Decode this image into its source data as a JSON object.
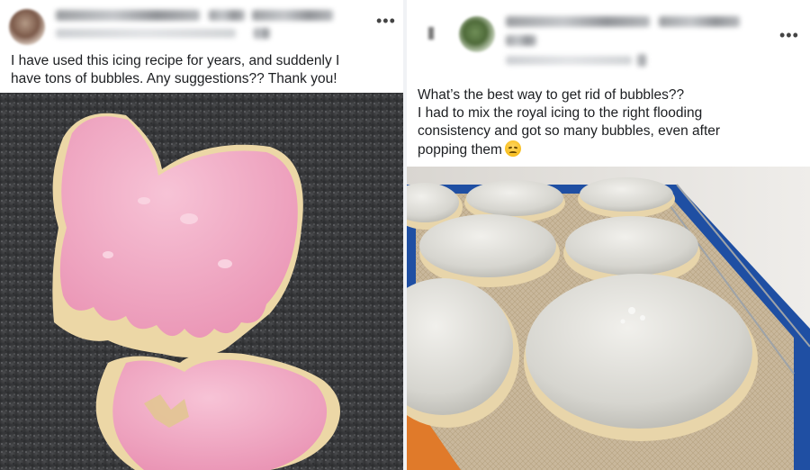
{
  "left_post": {
    "text_lines": [
      "I have used this icing recipe for years, and suddenly I",
      "have tons of bubbles.  Any suggestions?? Thank you!"
    ],
    "more_label": "•••",
    "photo_description": "pink-iced-butterfly-cookies"
  },
  "right_post": {
    "text_lines": [
      "What’s the best way to get rid of bubbles??",
      "I had to mix the royal icing to the right flooding",
      "consistency and got so many bubbles, even after",
      "popping them"
    ],
    "emoji": "disappointed-face",
    "more_label": "•••",
    "photo_description": "white-iced-round-cookies-on-rack"
  },
  "colors": {
    "pink_icing": "#f2a9c4",
    "cookie": "#efdcae",
    "counter": "#3c3d3f",
    "white_icing": "#d9d8d3",
    "silicone_mat": "#1f4fa3"
  }
}
